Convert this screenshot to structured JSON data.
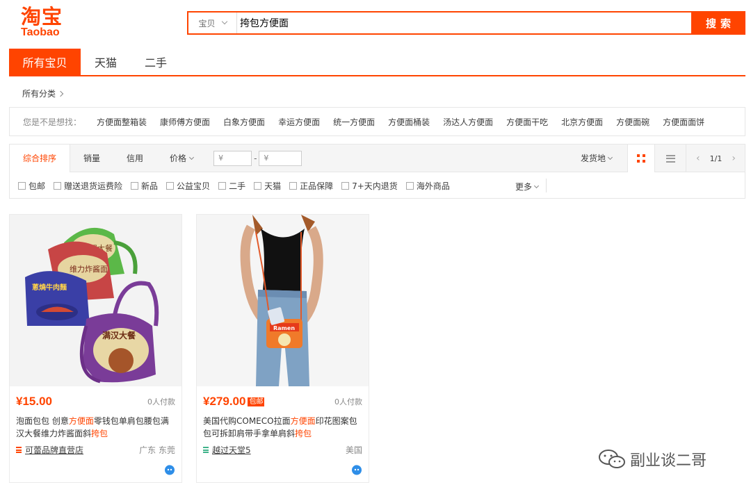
{
  "logo": {
    "zh": "淘宝",
    "en": "Taobao"
  },
  "search": {
    "scope": "宝贝",
    "query": "挎包方便面",
    "button": "搜索"
  },
  "tabs": [
    "所有宝贝",
    "天猫",
    "二手"
  ],
  "breadcrumb": "所有分类",
  "suggest": {
    "lead": "您是不是想找：",
    "items": [
      "方便面整箱装",
      "康师傅方便面",
      "白象方便面",
      "幸运方便面",
      "统一方便面",
      "方便面桶装",
      "汤达人方便面",
      "方便面干吃",
      "北京方便面",
      "方便面碗",
      "方便面面饼"
    ]
  },
  "sort": {
    "items": [
      "综合排序",
      "销量",
      "信用",
      "价格"
    ],
    "price_from": "¥",
    "price_to": "¥",
    "dash": "-",
    "ship_from": "发货地",
    "page": "1/1"
  },
  "filters": [
    "包邮",
    "赠送退货运费险",
    "新品",
    "公益宝贝",
    "二手",
    "天猫",
    "正品保障",
    "7+天内退货",
    "海外商品"
  ],
  "more": "更多",
  "products": [
    {
      "price": "¥15.00",
      "baoyou": "",
      "deals": "0人付款",
      "title_parts": [
        "泡面包包 创意",
        "方便面",
        "零钱包单肩包腰包满汉大餐维力炸酱面斜",
        "挎包"
      ],
      "shop": "可蕾品牌直营店",
      "location": "广东 东莞",
      "shop_color": "#ff4400"
    },
    {
      "price": "¥279.00",
      "baoyou": "包邮",
      "deals": "0人付款",
      "title_parts": [
        "美国代购COMECO拉面",
        "方便面",
        "印花图案包包可拆卸肩带手拿单肩斜",
        "挎包"
      ],
      "shop": "越过天堂5",
      "location": "美国",
      "shop_color": "#3fb38a"
    }
  ],
  "image_text": {
    "bag1": "满汉大餐",
    "bag2": "维力炸酱面",
    "bag3": "满汉大餐",
    "bag4": "蔥燒牛肉麵",
    "ramen": "Ramen"
  },
  "watermark": "副业谈二哥"
}
